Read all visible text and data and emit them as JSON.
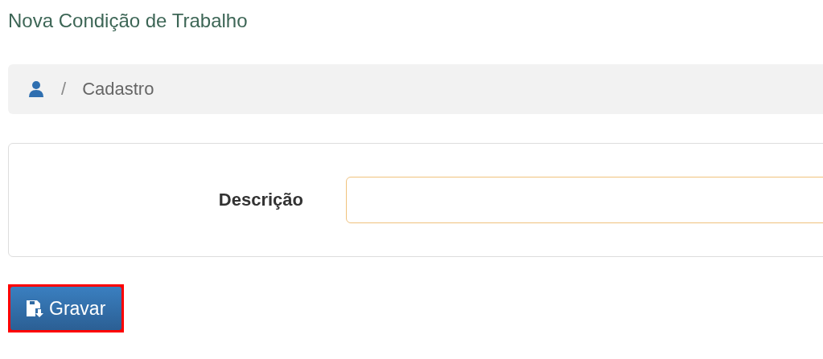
{
  "page_title": "Nova Condição de Trabalho",
  "breadcrumb": {
    "separator": "/",
    "items": [
      "Cadastro"
    ]
  },
  "form": {
    "fields": [
      {
        "label": "Descrição"
      }
    ]
  },
  "buttons": [
    {
      "label": "Gravar",
      "highlighted": true
    }
  ]
}
